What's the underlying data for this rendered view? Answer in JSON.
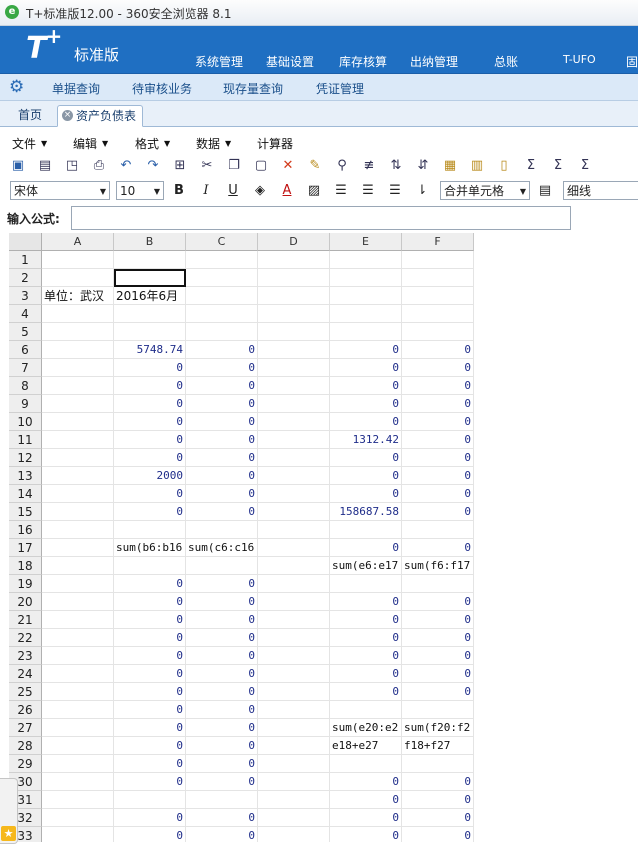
{
  "window": {
    "title": "T+标准版12.00 - 360安全浏览器 8.1",
    "icon": "360-browser-icon"
  },
  "brand": {
    "logo": "T",
    "logo_sup": "+",
    "name": "标准版"
  },
  "main_menu": [
    "系统管理",
    "基础设置",
    "库存核算",
    "出纳管理",
    "总账",
    "T-UFO",
    "固"
  ],
  "sub_nav": [
    "单据查询",
    "待审核业务",
    "现存量查询",
    "凭证管理"
  ],
  "tabs": {
    "home": "首页",
    "active": "资产负债表"
  },
  "menubar": [
    "文件",
    "编辑",
    "格式",
    "数据",
    "计算器"
  ],
  "toolbar2": {
    "font": "宋体",
    "size": "10",
    "merge": "合并单元格",
    "border": "细线"
  },
  "formula": {
    "label": "输入公式:",
    "value": ""
  },
  "grid": {
    "columns": [
      "A",
      "B",
      "C",
      "D",
      "E",
      "F"
    ],
    "rows": [
      {
        "n": "1",
        "A": "",
        "B": "",
        "C": "",
        "D": "",
        "E": "",
        "F": ""
      },
      {
        "n": "2",
        "A": "",
        "B": "",
        "C": "",
        "D": "",
        "E": "",
        "F": ""
      },
      {
        "n": "3",
        "A": "单位：武汉",
        "B": "2016年6月",
        "C": "",
        "D": "",
        "E": "",
        "F": ""
      },
      {
        "n": "4",
        "A": "",
        "B": "",
        "C": "",
        "D": "",
        "E": "",
        "F": ""
      },
      {
        "n": "5",
        "A": "",
        "B": "",
        "C": "",
        "D": "",
        "E": "",
        "F": ""
      },
      {
        "n": "6",
        "A": "",
        "B": "5748.74",
        "C": "0",
        "D": "",
        "E": "0",
        "F": "0"
      },
      {
        "n": "7",
        "A": "",
        "B": "0",
        "C": "0",
        "D": "",
        "E": "0",
        "F": "0"
      },
      {
        "n": "8",
        "A": "",
        "B": "0",
        "C": "0",
        "D": "",
        "E": "0",
        "F": "0"
      },
      {
        "n": "9",
        "A": "",
        "B": "0",
        "C": "0",
        "D": "",
        "E": "0",
        "F": "0"
      },
      {
        "n": "10",
        "A": "",
        "B": "0",
        "C": "0",
        "D": "",
        "E": "0",
        "F": "0"
      },
      {
        "n": "11",
        "A": "",
        "B": "0",
        "C": "0",
        "D": "",
        "E": "1312.42",
        "F": "0"
      },
      {
        "n": "12",
        "A": "",
        "B": "0",
        "C": "0",
        "D": "",
        "E": "0",
        "F": "0"
      },
      {
        "n": "13",
        "A": "",
        "B": "2000",
        "C": "0",
        "D": "",
        "E": "0",
        "F": "0"
      },
      {
        "n": "14",
        "A": "",
        "B": "0",
        "C": "0",
        "D": "",
        "E": "0",
        "F": "0"
      },
      {
        "n": "15",
        "A": "",
        "B": "0",
        "C": "0",
        "D": "",
        "E": "158687.58",
        "F": "0"
      },
      {
        "n": "16",
        "A": "",
        "B": "",
        "C": "",
        "D": "",
        "E": "",
        "F": ""
      },
      {
        "n": "17",
        "A": "",
        "B": "sum(b6:b16",
        "C": "sum(c6:c16",
        "D": "",
        "E": "0",
        "F": "0"
      },
      {
        "n": "18",
        "A": "",
        "B": "",
        "C": "",
        "D": "",
        "E": "sum(e6:e17",
        "F": "sum(f6:f17"
      },
      {
        "n": "19",
        "A": "",
        "B": "0",
        "C": "0",
        "D": "",
        "E": "",
        "F": ""
      },
      {
        "n": "20",
        "A": "",
        "B": "0",
        "C": "0",
        "D": "",
        "E": "0",
        "F": "0"
      },
      {
        "n": "21",
        "A": "",
        "B": "0",
        "C": "0",
        "D": "",
        "E": "0",
        "F": "0"
      },
      {
        "n": "22",
        "A": "",
        "B": "0",
        "C": "0",
        "D": "",
        "E": "0",
        "F": "0"
      },
      {
        "n": "23",
        "A": "",
        "B": "0",
        "C": "0",
        "D": "",
        "E": "0",
        "F": "0"
      },
      {
        "n": "24",
        "A": "",
        "B": "0",
        "C": "0",
        "D": "",
        "E": "0",
        "F": "0"
      },
      {
        "n": "25",
        "A": "",
        "B": "0",
        "C": "0",
        "D": "",
        "E": "0",
        "F": "0"
      },
      {
        "n": "26",
        "A": "",
        "B": "0",
        "C": "0",
        "D": "",
        "E": "",
        "F": ""
      },
      {
        "n": "27",
        "A": "",
        "B": "0",
        "C": "0",
        "D": "",
        "E": "sum(e20:e2",
        "F": "sum(f20:f2"
      },
      {
        "n": "28",
        "A": "",
        "B": "0",
        "C": "0",
        "D": "",
        "E": "e18+e27",
        "F": "f18+f27"
      },
      {
        "n": "29",
        "A": "",
        "B": "0",
        "C": "0",
        "D": "",
        "E": "",
        "F": ""
      },
      {
        "n": "30",
        "A": "",
        "B": "0",
        "C": "0",
        "D": "",
        "E": "0",
        "F": "0"
      },
      {
        "n": "31",
        "A": "",
        "B": "",
        "C": "",
        "D": "",
        "E": "0",
        "F": "0"
      },
      {
        "n": "32",
        "A": "",
        "B": "0",
        "C": "0",
        "D": "",
        "E": "0",
        "F": "0"
      },
      {
        "n": "33",
        "A": "",
        "B": "0",
        "C": "0",
        "D": "",
        "E": "0",
        "F": "0"
      }
    ]
  },
  "colors": {
    "brand_blue": "#1f6fc2",
    "subnav_bg": "#dbe9f8",
    "cell_number": "#1f2d8a"
  }
}
